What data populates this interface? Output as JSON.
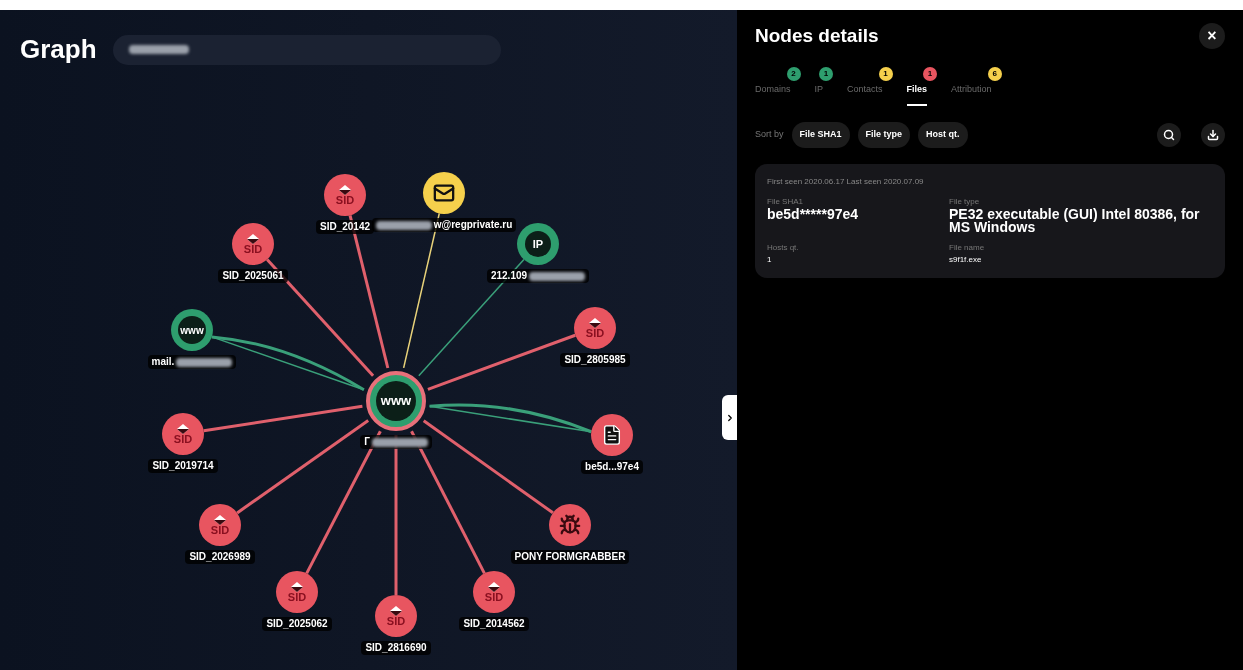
{
  "graph": {
    "title": "Graph",
    "search": {
      "value_parts": [
        {
          "kind": "redacted"
        }
      ]
    },
    "center": {
      "kind": "domain",
      "badge": "www",
      "label_parts": [
        {
          "kind": "text",
          "text": "Г"
        },
        {
          "kind": "redacted"
        }
      ]
    },
    "nodes": [
      {
        "kind": "sid",
        "badge": "SID",
        "label_parts": [
          {
            "kind": "text",
            "text": "SID_20142"
          }
        ]
      },
      {
        "kind": "email",
        "label_parts": [
          {
            "kind": "redacted"
          },
          {
            "kind": "text",
            "text": "w@regprivate.ru"
          }
        ]
      },
      {
        "kind": "sid",
        "badge": "SID",
        "label_parts": [
          {
            "kind": "text",
            "text": "SID_2025061"
          }
        ]
      },
      {
        "kind": "ip",
        "badge": "IP",
        "label_parts": [
          {
            "kind": "text",
            "text": "212.109"
          },
          {
            "kind": "redacted"
          }
        ]
      },
      {
        "kind": "domain",
        "badge": "www",
        "label_parts": [
          {
            "kind": "text",
            "text": "mail."
          },
          {
            "kind": "redacted"
          }
        ]
      },
      {
        "kind": "sid",
        "badge": "SID",
        "label_parts": [
          {
            "kind": "text",
            "text": "SID_2805985"
          }
        ]
      },
      {
        "kind": "sid",
        "badge": "SID",
        "label_parts": [
          {
            "kind": "text",
            "text": "SID_2019714"
          }
        ]
      },
      {
        "kind": "file",
        "label_parts": [
          {
            "kind": "text",
            "text": "be5d...97e4"
          }
        ]
      },
      {
        "kind": "sid",
        "badge": "SID",
        "label_parts": [
          {
            "kind": "text",
            "text": "SID_2026989"
          }
        ]
      },
      {
        "kind": "malware",
        "label_parts": [
          {
            "kind": "text",
            "text": "PONY FORMGRABBER"
          }
        ]
      },
      {
        "kind": "sid",
        "badge": "SID",
        "label_parts": [
          {
            "kind": "text",
            "text": "SID_2025062"
          }
        ]
      },
      {
        "kind": "sid",
        "badge": "SID",
        "label_parts": [
          {
            "kind": "text",
            "text": "SID_2014562"
          }
        ]
      },
      {
        "kind": "sid",
        "badge": "SID",
        "label_parts": [
          {
            "kind": "text",
            "text": "SID_2816690"
          }
        ]
      }
    ]
  },
  "details": {
    "title": "Nodes details",
    "close": "×",
    "tabs": [
      {
        "label": "Domains",
        "count": "2",
        "color": "#2e9e6e",
        "selected": false
      },
      {
        "label": "IP",
        "count": "1",
        "color": "#2e9e6e",
        "selected": false
      },
      {
        "label": "Contacts",
        "count": "1",
        "color": "#f5d04c",
        "selected": false
      },
      {
        "label": "Files",
        "count": "1",
        "color": "#e85560",
        "selected": true
      },
      {
        "label": "Attribution",
        "count": "6",
        "color": "#f5d04c",
        "selected": false
      }
    ],
    "sort_label": "Sort by",
    "sort_options": [
      "File SHA1",
      "File type",
      "Host qt."
    ],
    "card": {
      "seen": "First seen 2020.06.17 Last seen 2020.07.09",
      "fields": [
        {
          "label": "File SHA1",
          "value": "be5d*****97e4",
          "kind": "large"
        },
        {
          "label": "File type",
          "value": "PE32 executable (GUI) Intel 80386, for MS Windows",
          "kind": "large"
        },
        {
          "label": "Hosts qt.",
          "value": "1",
          "kind": "small"
        },
        {
          "label": "File name",
          "value": "s9f1f.exe",
          "kind": "small"
        }
      ]
    }
  }
}
